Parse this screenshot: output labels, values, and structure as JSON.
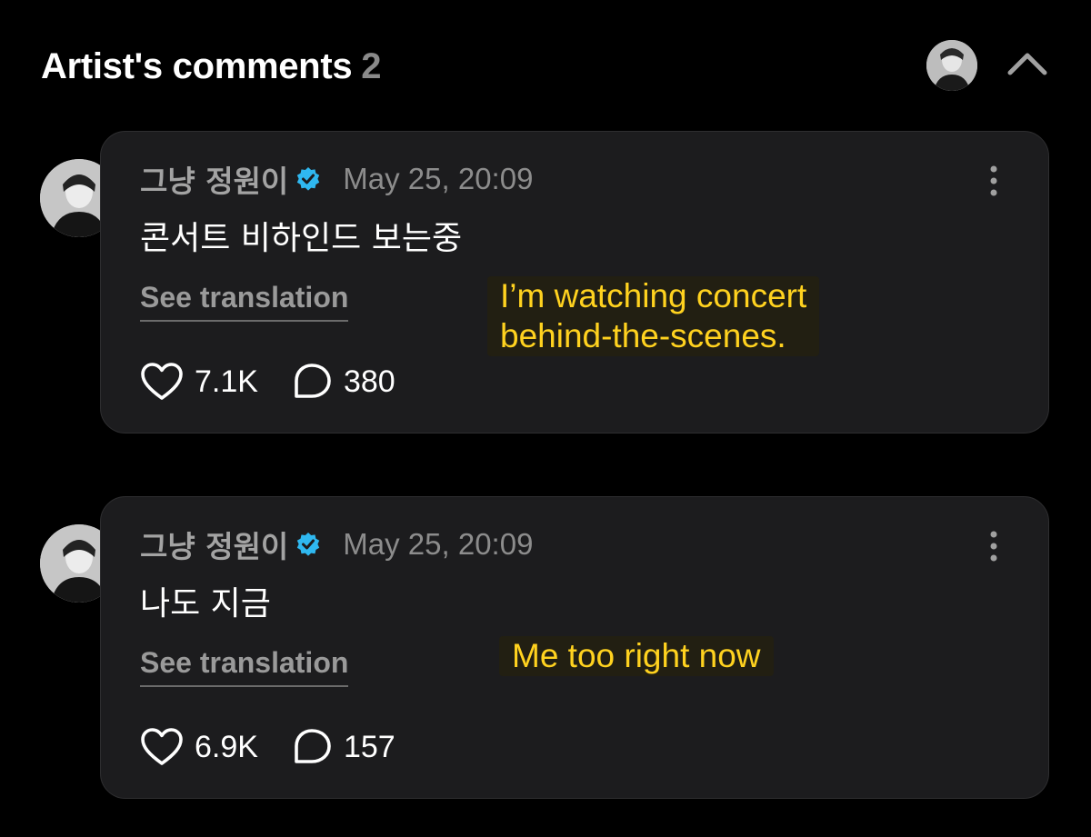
{
  "section": {
    "title": "Artist's comments",
    "count": "2"
  },
  "icons": {
    "verified_color": "#2fb8f0",
    "translation_overlay_color": "#ffd21f"
  },
  "comments": [
    {
      "author": "그냥 정원이",
      "timestamp": "May 25, 20:09",
      "body": "콘서트 비하인드 보는중",
      "see_translation": "See translation",
      "translation_overlay_lines": [
        "I’m watching concert",
        "behind-the-scenes."
      ],
      "likes": "7.1K",
      "replies": "380"
    },
    {
      "author": "그냥 정원이",
      "timestamp": "May 25, 20:09",
      "body": "나도 지금",
      "see_translation": "See translation",
      "translation_overlay_lines": [
        "Me too right now"
      ],
      "likes": "6.9K",
      "replies": "157"
    }
  ]
}
